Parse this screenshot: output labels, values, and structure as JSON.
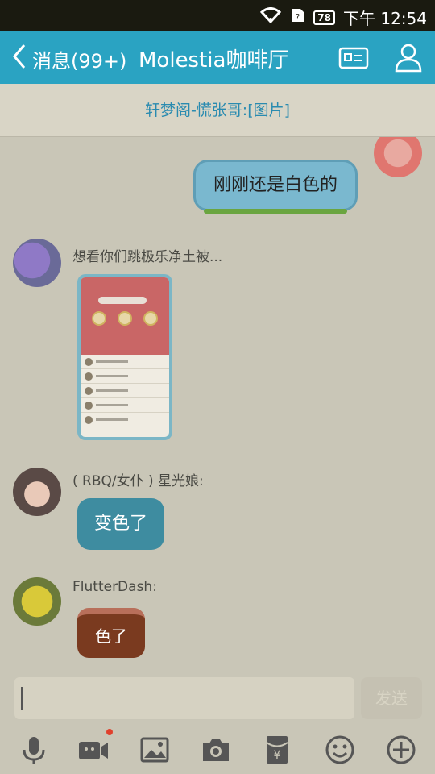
{
  "status_bar": {
    "battery": "78",
    "time": "下午 12:54"
  },
  "header": {
    "back_label": "消息(99+)",
    "title": "Molestia咖啡厅"
  },
  "notice": {
    "text": "轩梦阁-慌张哥:[图片]"
  },
  "messages": [
    {
      "side": "right",
      "text": "刚刚还是白色的"
    },
    {
      "side": "left",
      "sender": "想看你们跳极乐净土被...",
      "type": "image"
    },
    {
      "side": "left",
      "sender": "( RBQ/女仆 ) 星光娘:",
      "text": "变色了"
    },
    {
      "side": "left",
      "sender": "FlutterDash:",
      "text": "色了"
    }
  ],
  "input": {
    "send_label": "发送"
  },
  "toolbar": [
    "mic-icon",
    "video-icon",
    "image-icon",
    "camera-icon",
    "red-packet-icon",
    "emoji-icon",
    "plus-icon"
  ],
  "colors": {
    "header": "#2aa3c2",
    "notice_text": "#2a8bb0",
    "chat_bg": "#c9c6b7"
  }
}
